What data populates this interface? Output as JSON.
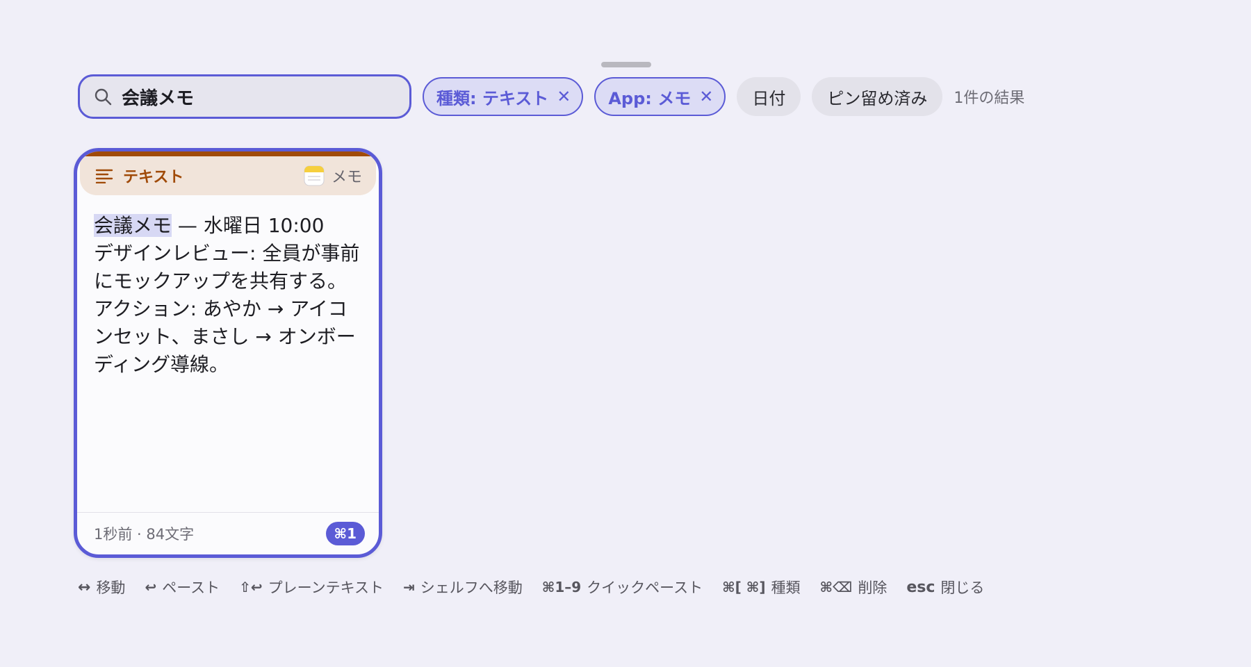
{
  "filters": {
    "search_value": "会議メモ",
    "chips": [
      {
        "label": "種類: テキスト",
        "active": true
      },
      {
        "label": "App: メモ",
        "active": true
      },
      {
        "label": "日付",
        "active": false
      },
      {
        "label": "ピン留め済み",
        "active": false
      }
    ],
    "result_count": "1件の結果"
  },
  "card": {
    "type_label": "テキスト",
    "type_icon": "text-lines-icon",
    "app_label": "メモ",
    "app_icon": "notes-app-icon",
    "highlight": "会議メモ",
    "title_rest": " — 水曜日 10:00",
    "line2": "デザインレビュー: 全員が事前にモックアップを共有する。",
    "line3": "アクション: あやか → アイコンセット、まさし → オンボーディング導線。",
    "meta": "1秒前 · 84文字",
    "shortcut": "⌘1"
  },
  "hints": [
    {
      "key": "↔",
      "label": "移動"
    },
    {
      "key": "↩",
      "label": "ペースト"
    },
    {
      "key": "⇧↩",
      "label": "プレーンテキスト"
    },
    {
      "key": "⇥",
      "label": "シェルフへ移動"
    },
    {
      "key": "⌘1–9",
      "label": "クイックペースト"
    },
    {
      "key": "⌘[ ⌘]",
      "label": "種類"
    },
    {
      "key": "⌘⌫",
      "label": "削除"
    },
    {
      "key": "esc",
      "label": "閉じる"
    }
  ],
  "colors": {
    "accent": "#5b5bd6",
    "text_type": "#a04a08",
    "background": "#f0eff8"
  }
}
